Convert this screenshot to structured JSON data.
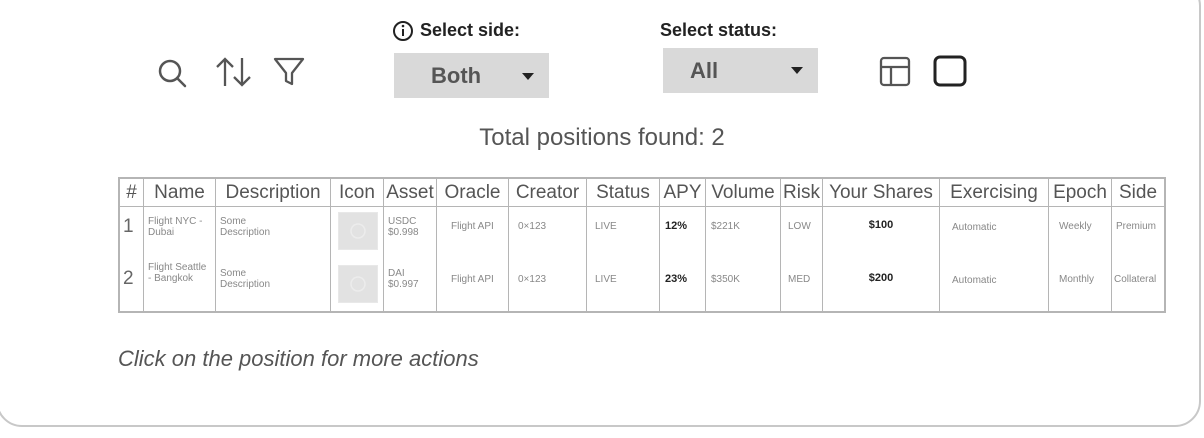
{
  "toolbar": {
    "icons": [
      "search-icon",
      "sort-icon",
      "filter-icon",
      "table-view-icon",
      "card-view-icon"
    ]
  },
  "filters": {
    "side": {
      "label": "Select side:",
      "value": "Both"
    },
    "status": {
      "label": "Select status:",
      "value": "All"
    }
  },
  "total_label": "Total positions found: 2",
  "table": {
    "headers": [
      "#",
      "Name",
      "Description",
      "Icon",
      "Asset",
      "Oracle",
      "Creator",
      "Status",
      "APY",
      "Volume",
      "Risk",
      "Your Shares",
      "Exercising",
      "Epoch",
      "Side"
    ],
    "rows": [
      {
        "num": "1",
        "name": "Flight NYC - Dubai",
        "description": "Some Description",
        "asset": "USDC",
        "asset_price": "$0.998",
        "oracle": "Flight API",
        "creator": "0×123",
        "status": "LIVE",
        "apy": "12%",
        "volume": "$221K",
        "risk": "LOW",
        "shares": "$100",
        "exercising": "Automatic",
        "epoch": "Weekly",
        "side": "Premium"
      },
      {
        "num": "2",
        "name": "Flight Seattle - Bangkok",
        "description": "Some Description",
        "asset": "DAI",
        "asset_price": "$0.997",
        "oracle": "Flight API",
        "creator": "0×123",
        "status": "LIVE",
        "apy": "23%",
        "volume": "$350K",
        "risk": "MED",
        "shares": "$200",
        "exercising": "Automatic",
        "epoch": "Monthly",
        "side": "Collateral"
      }
    ]
  },
  "hint": "Click on the position for more actions"
}
